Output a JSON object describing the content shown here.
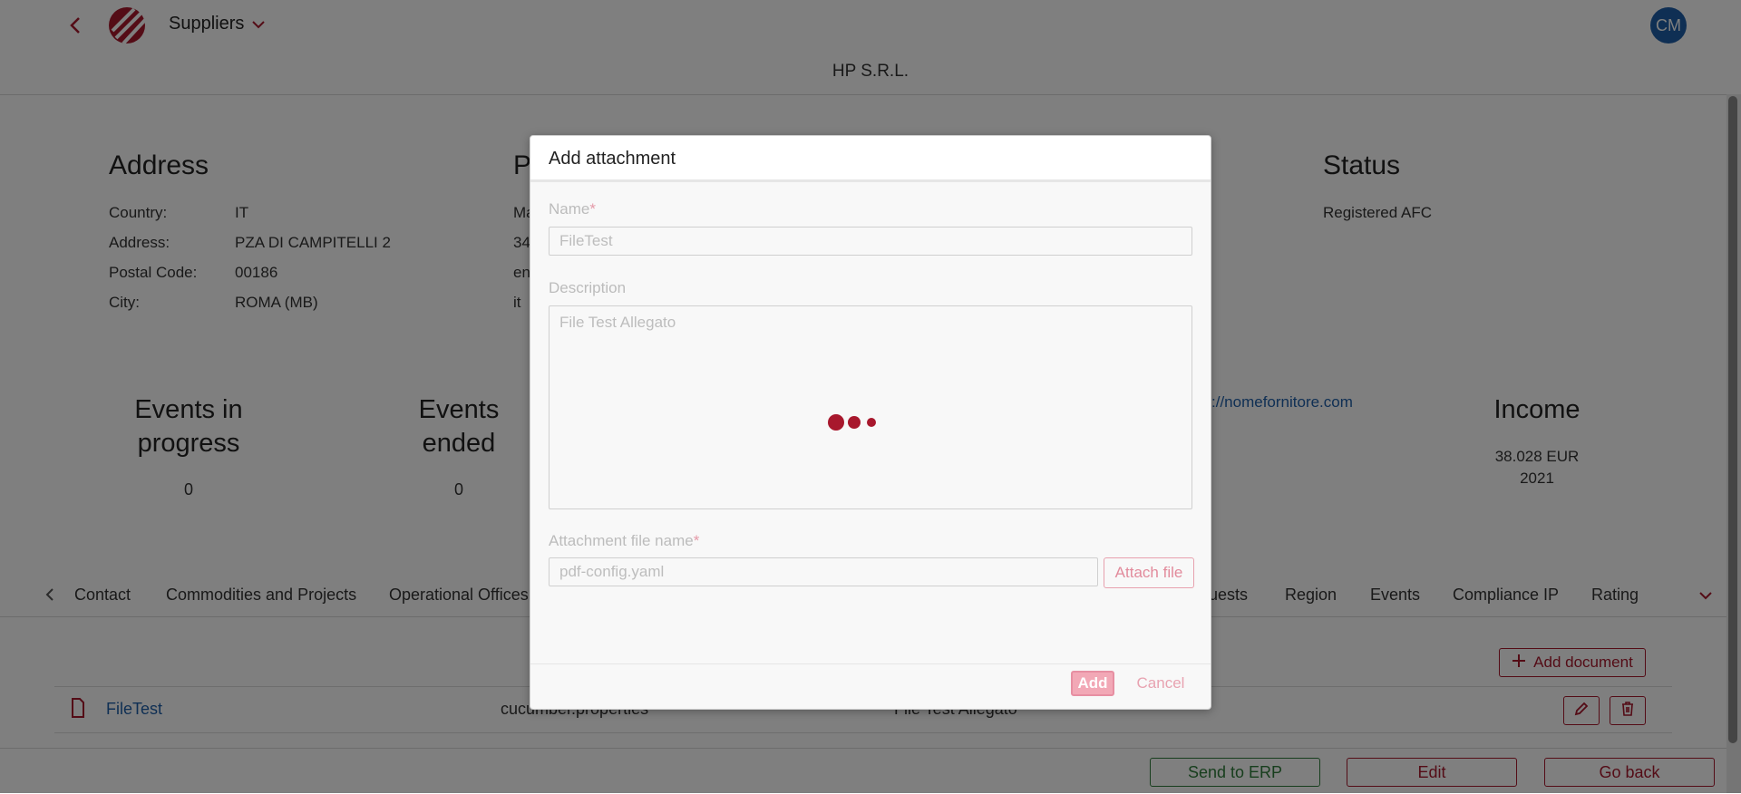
{
  "header": {
    "app_title": "Suppliers",
    "avatar_initials": "CM",
    "company_name": "HP S.R.L."
  },
  "address": {
    "title": "Address",
    "rows": [
      {
        "label": "Country:",
        "value": "IT"
      },
      {
        "label": "Address:",
        "value": "PZA DI CAMPITELLI 2"
      },
      {
        "label": "Postal Code:",
        "value": "00186"
      },
      {
        "label": "City:",
        "value": "ROMA (MB)"
      }
    ]
  },
  "second_section": {
    "title_partial": "P",
    "lines_partial": [
      "Ma",
      "34",
      "en",
      "it"
    ]
  },
  "status": {
    "title": "Status",
    "value": "Registered AFC"
  },
  "stats": {
    "events_in_progress": {
      "title_line1": "Events in",
      "title_line2": "progress",
      "value": "0"
    },
    "events_ended": {
      "title_line1": "Events",
      "title_line2": "ended",
      "value": "0"
    },
    "website_partial": "://nomefornitore.com",
    "income": {
      "title": "Income",
      "amount": "38.028 EUR",
      "year": "2021"
    }
  },
  "tabs": {
    "left": [
      "Contact",
      "Commodities and Projects",
      "Operational Offices"
    ],
    "right": [
      "uests",
      "Region",
      "Events",
      "Compliance IP",
      "Rating"
    ]
  },
  "documents": {
    "add_label": "Add document",
    "rows": [
      {
        "name": "FileTest",
        "file": "cucumber.properties",
        "description": "File Test Allegato"
      }
    ]
  },
  "footer": {
    "send_label": "Send to ERP",
    "edit_label": "Edit",
    "back_label": "Go back"
  },
  "modal": {
    "title": "Add attachment",
    "name_label": "Name",
    "name_value": "FileTest",
    "description_label": "Description",
    "description_value": "File Test Allegato",
    "file_label": "Attachment file name",
    "file_value": "pdf-config.yaml",
    "attach_label": "Attach file",
    "add_label": "Add",
    "cancel_label": "Cancel",
    "required_mark": "*"
  },
  "colors": {
    "brand": "#a8182d",
    "link": "#1f5fa8",
    "avatar_bg": "#1f5fa8",
    "send_green": "#2f7d3b"
  }
}
